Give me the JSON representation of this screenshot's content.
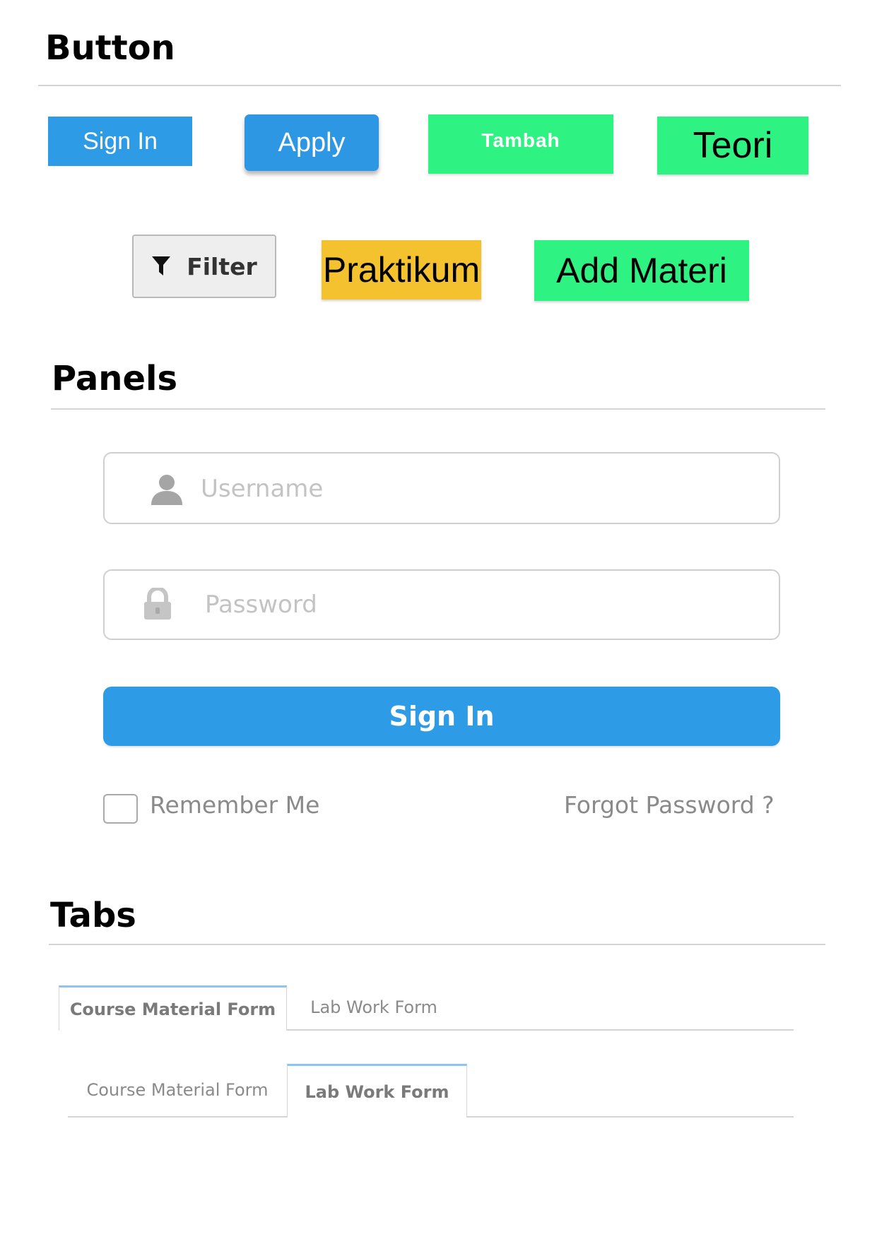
{
  "sections": {
    "buttons_title": "Button",
    "panels_title": "Panels",
    "tabs_title": "Tabs"
  },
  "buttons": {
    "sign_in": "Sign In",
    "apply": "Apply",
    "tambah": "Tambah",
    "teori": "Teori",
    "filter": "Filter",
    "praktikum": "Praktikum",
    "add_materi": "Add Materi"
  },
  "login": {
    "username_placeholder": "Username",
    "password_placeholder": "Password",
    "sign_in": "Sign In",
    "remember_me": "Remember Me",
    "forgot_password": "Forgot Password ?"
  },
  "tabs": {
    "set1": {
      "items": [
        "Course Material Form",
        "Lab Work Form"
      ],
      "active": "Course Material Form"
    },
    "set2": {
      "items": [
        "Course Material Form",
        "Lab Work Form"
      ],
      "active": "Lab Work Form"
    }
  },
  "colors": {
    "blue": "#2e9be6",
    "green": "#2ef281",
    "yellow": "#f4c22f",
    "filter_gray": "#eeeeee",
    "tab_accent": "#8fc4ef"
  },
  "icons": {
    "filter": "filter-funnel-icon",
    "username": "user-icon",
    "password": "lock-icon"
  }
}
